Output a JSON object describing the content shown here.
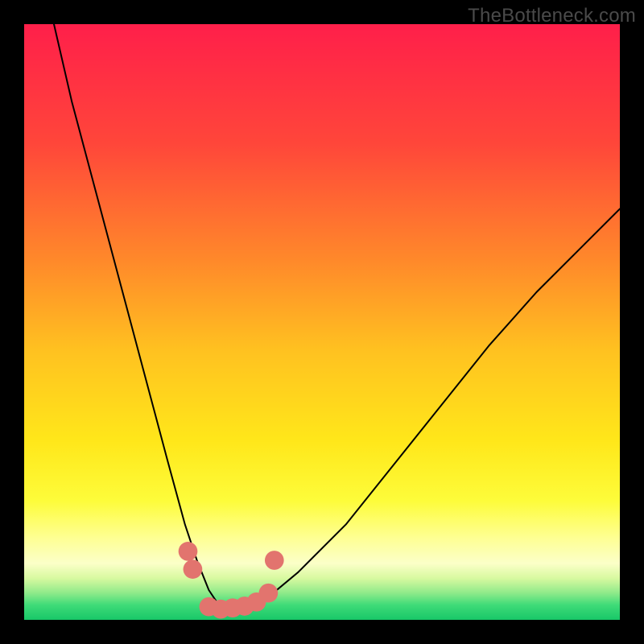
{
  "watermark": "TheBottleneck.com",
  "chart_data": {
    "type": "line",
    "title": "",
    "xlabel": "",
    "ylabel": "",
    "xlim": [
      0,
      100
    ],
    "ylim": [
      0,
      100
    ],
    "grid": false,
    "legend": false,
    "series": [
      {
        "name": "bottleneck-curve",
        "x": [
          5,
          8,
          12,
          16,
          20,
          24,
          27,
          29,
          31,
          33,
          35,
          40,
          46,
          54,
          62,
          70,
          78,
          86,
          94,
          100
        ],
        "y": [
          100,
          87,
          72,
          57,
          42,
          27,
          16,
          10,
          5,
          2,
          2,
          3,
          8,
          16,
          26,
          36,
          46,
          55,
          63,
          69
        ]
      }
    ],
    "markers": [
      {
        "x": 27.5,
        "y": 11.5
      },
      {
        "x": 28.3,
        "y": 8.5
      },
      {
        "x": 31.0,
        "y": 2.2
      },
      {
        "x": 33.0,
        "y": 1.8
      },
      {
        "x": 35.0,
        "y": 2.0
      },
      {
        "x": 37.0,
        "y": 2.3
      },
      {
        "x": 39.0,
        "y": 3.0
      },
      {
        "x": 41.0,
        "y": 4.5
      },
      {
        "x": 42.0,
        "y": 10.0
      }
    ],
    "background_gradient": {
      "stops": [
        {
          "offset": 0.0,
          "color": "#ff1f4a"
        },
        {
          "offset": 0.2,
          "color": "#ff463a"
        },
        {
          "offset": 0.4,
          "color": "#ff8a2a"
        },
        {
          "offset": 0.55,
          "color": "#ffc220"
        },
        {
          "offset": 0.7,
          "color": "#ffe71a"
        },
        {
          "offset": 0.8,
          "color": "#fdfc3a"
        },
        {
          "offset": 0.86,
          "color": "#feff90"
        },
        {
          "offset": 0.905,
          "color": "#fbffc8"
        },
        {
          "offset": 0.93,
          "color": "#d8f9a0"
        },
        {
          "offset": 0.955,
          "color": "#8eea8a"
        },
        {
          "offset": 0.975,
          "color": "#3fdb78"
        },
        {
          "offset": 1.0,
          "color": "#18c768"
        }
      ]
    },
    "colors": {
      "curve": "#000000",
      "marker_fill": "#e2746e",
      "frame": "#000000"
    }
  }
}
